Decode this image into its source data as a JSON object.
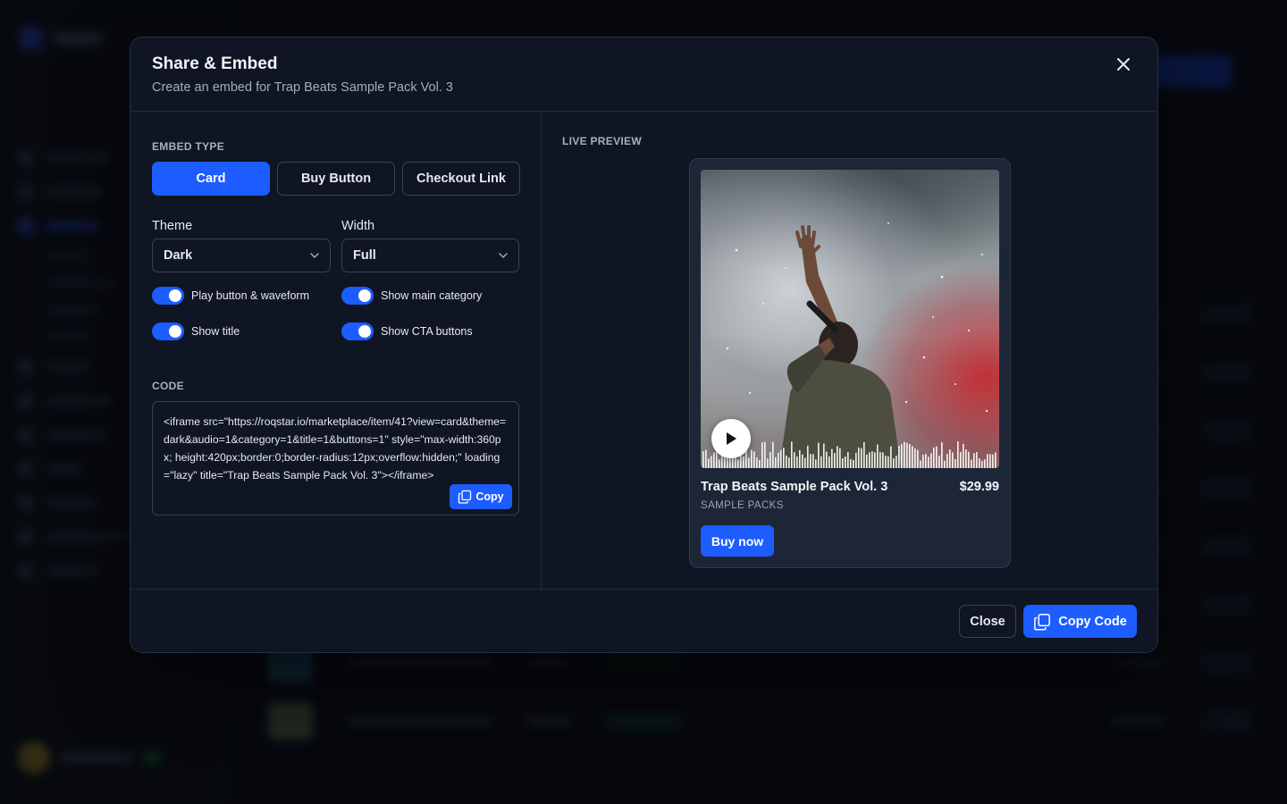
{
  "modal": {
    "title": "Share & Embed",
    "subtitle": "Create an embed for Trap Beats Sample Pack Vol. 3",
    "close_icon": "close-icon"
  },
  "embed_type": {
    "label": "EMBED TYPE",
    "options": [
      "Card",
      "Buy Button",
      "Checkout Link"
    ],
    "selected": "Card"
  },
  "theme": {
    "label": "Theme",
    "value": "Dark"
  },
  "width": {
    "label": "Width",
    "value": "Full"
  },
  "toggles": [
    {
      "label": "Play button & waveform",
      "on": true
    },
    {
      "label": "Show main category",
      "on": true
    },
    {
      "label": "Show title",
      "on": true
    },
    {
      "label": "Show CTA buttons",
      "on": true
    }
  ],
  "code": {
    "label": "CODE",
    "snippet": "<iframe src=\"https://roqstar.io/marketplace/item/41?view=card&theme=dark&audio=1&category=1&title=1&buttons=1\" style=\"max-width:360px; height:420px;border:0;border-radius:12px;overflow:hidden;\" loading=\"lazy\" title=\"Trap Beats Sample Pack Vol. 3\"></iframe>",
    "copy_label": "Copy"
  },
  "preview": {
    "label": "LIVE PREVIEW",
    "title": "Trap Beats Sample Pack Vol. 3",
    "price": "$29.99",
    "category": "SAMPLE PACKS",
    "cta": "Buy now"
  },
  "footer": {
    "close_label": "Close",
    "copy_code_label": "Copy Code"
  },
  "colors": {
    "accent": "#1d5cff",
    "modal_bg": "#0f1522",
    "card_bg": "#1c2637"
  }
}
